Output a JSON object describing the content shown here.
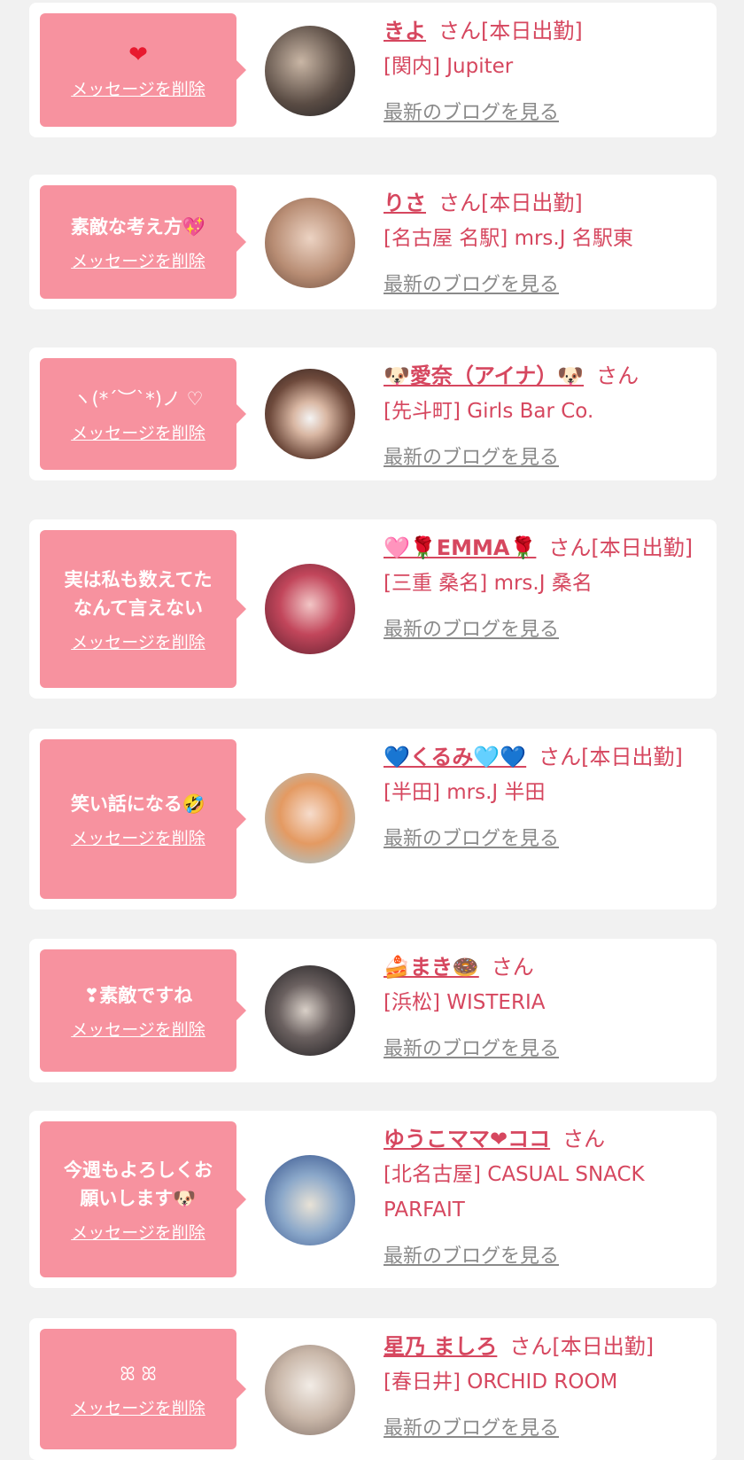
{
  "accent_color": "#f7929f",
  "name_color": "#d6475f",
  "blog_link_color": "#8a8a8a",
  "cards": [
    {
      "message": "❤",
      "delete_label": "メッセージを削除",
      "name": "きよ",
      "suffix": "さん[本日出勤]",
      "shop": "[関内] Jupiter",
      "blog_label": "最新のブログを見る"
    },
    {
      "message": "素敵な考え方💖",
      "delete_label": "メッセージを削除",
      "name": "りさ",
      "suffix": "さん[本日出勤]",
      "shop": "[名古屋 名駅] mrs.J 名駅東",
      "blog_label": "最新のブログを見る"
    },
    {
      "message": "ヽ(*´︶`*)ノ ♡",
      "delete_label": "メッセージを削除",
      "name": "🐶愛奈（アイナ）🐶",
      "suffix": "さん",
      "shop": "[先斗町] Girls Bar Co.",
      "blog_label": "最新のブログを見る"
    },
    {
      "message": "実は私も数えてた\nなんて言えない",
      "delete_label": "メッセージを削除",
      "name": "🩷🌹EMMA🌹",
      "suffix": "さん[本日出勤]",
      "shop": "[三重 桑名] mrs.J 桑名",
      "blog_label": "最新のブログを見る"
    },
    {
      "message": "笑い話になる🤣",
      "delete_label": "メッセージを削除",
      "name": "💙くるみ🩵💙",
      "suffix": "さん[本日出勤]",
      "shop": "[半田] mrs.J 半田",
      "blog_label": "最新のブログを見る"
    },
    {
      "message": "❣素敵ですね",
      "delete_label": "メッセージを削除",
      "name": "🍰まき🍩",
      "suffix": "さん",
      "shop": "[浜松] WISTERIA",
      "blog_label": "最新のブログを見る"
    },
    {
      "message": "今週もよろしくお\n願いします🐶",
      "delete_label": "メッセージを削除",
      "name": "ゆうこママ❤ココ",
      "suffix": "さん",
      "shop": "[北名古屋] CASUAL SNACK PARFAIT",
      "blog_label": "最新のブログを見る"
    },
    {
      "message": "ꕤ ꕤ",
      "delete_label": "メッセージを削除",
      "name": "星乃 ましろ",
      "suffix": "さん[本日出勤]",
      "shop": "[春日井] ORCHID ROOM",
      "blog_label": "最新のブログを見る"
    }
  ]
}
